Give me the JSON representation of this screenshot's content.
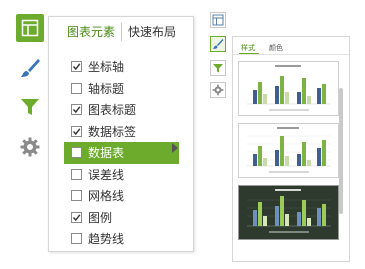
{
  "rail": {
    "buttons": [
      {
        "name": "chart-elements-icon",
        "active": true
      },
      {
        "name": "brush-icon",
        "active": false
      },
      {
        "name": "filter-icon",
        "active": false
      },
      {
        "name": "gear-icon",
        "active": false
      }
    ]
  },
  "elements_panel": {
    "tabs": {
      "active": "图表元素",
      "inactive": "快速布局"
    },
    "items": [
      {
        "label": "坐标轴",
        "checked": true
      },
      {
        "label": "轴标题",
        "checked": false
      },
      {
        "label": "图表标题",
        "checked": true
      },
      {
        "label": "数据标签",
        "checked": true
      },
      {
        "label": "数据表",
        "checked": false,
        "highlighted": true
      },
      {
        "label": "误差线",
        "checked": false
      },
      {
        "label": "网格线",
        "checked": false
      },
      {
        "label": "图例",
        "checked": true
      },
      {
        "label": "趋势线",
        "checked": false
      }
    ]
  },
  "style_panel": {
    "tabs": {
      "active": "样式",
      "inactive": "颜色"
    }
  },
  "colors": {
    "accent": "#6cab2c",
    "accent_text": "#4a8a16",
    "bar_blue": "#3f5f8f",
    "bar_green": "#7cb342",
    "bar_light": "#c7dba8"
  }
}
